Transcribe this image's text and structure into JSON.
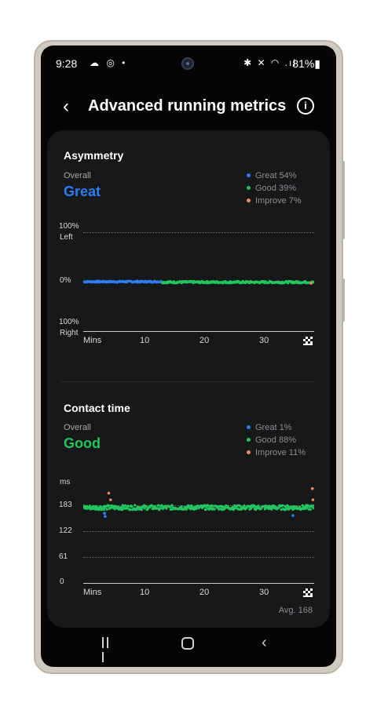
{
  "status_bar": {
    "time": "9:28",
    "left_icons": "☁ ◎ •",
    "right_icons": "✱ ✕ ◠ .ıl",
    "battery": "81%▮"
  },
  "header": {
    "back_glyph": "‹",
    "title": "Advanced running metrics",
    "info_glyph": "i"
  },
  "asymmetry": {
    "title": "Asymmetry",
    "overall_label": "Overall",
    "rating": "Great",
    "rating_color": "#2f7cf6",
    "legend": [
      {
        "label": "Great 54%",
        "color": "#2f7cf6"
      },
      {
        "label": "Good 39%",
        "color": "#22c55e"
      },
      {
        "label": "Improve 7%",
        "color": "#f08a5d"
      }
    ],
    "y_labels": {
      "top": "100%",
      "top_sub": "Left",
      "mid": "0%",
      "bottom": "100%",
      "bottom_sub": "Right"
    },
    "x_labels": [
      "Mins",
      "10",
      "20",
      "30"
    ]
  },
  "contact_time": {
    "title": "Contact time",
    "overall_label": "Overall",
    "rating": "Good",
    "rating_color": "#22c55e",
    "legend": [
      {
        "label": "Great 1%",
        "color": "#2f7cf6"
      },
      {
        "label": "Good 88%",
        "color": "#22c55e"
      },
      {
        "label": "Improve 11%",
        "color": "#f08a5d"
      }
    ],
    "unit": "ms",
    "y_labels": [
      "183",
      "122",
      "61",
      "0"
    ],
    "x_labels": [
      "Mins",
      "10",
      "20",
      "30"
    ],
    "average": "Avg. 168"
  },
  "chart_data": [
    {
      "type": "scatter",
      "title": "Asymmetry",
      "xlabel": "Mins",
      "ylabel": "",
      "xlim": [
        0,
        38
      ],
      "ylim": [
        -100,
        100
      ],
      "grid": true,
      "series": [
        {
          "name": "Great",
          "color": "#2f7cf6",
          "x_range": [
            0,
            13
          ],
          "y_center": 0,
          "spread": 1.5
        },
        {
          "name": "Good",
          "color": "#22c55e",
          "x_range": [
            13,
            38
          ],
          "y_center": -1,
          "spread": 2
        },
        {
          "name": "Improve",
          "color": "#f08a5d",
          "points": [
            [
              37.5,
              -3
            ]
          ]
        }
      ]
    },
    {
      "type": "scatter",
      "title": "Contact time",
      "xlabel": "Mins",
      "ylabel": "ms",
      "xlim": [
        0,
        38
      ],
      "ylim": [
        0,
        220
      ],
      "yticks": [
        0,
        61,
        122,
        183
      ],
      "grid": true,
      "series": [
        {
          "name": "Good",
          "color": "#22c55e",
          "x_range": [
            0,
            38
          ],
          "y_center": 168,
          "spread": 5
        },
        {
          "name": "Improve",
          "color": "#f08a5d",
          "points": [
            [
              4.2,
              200
            ],
            [
              4.5,
              185
            ],
            [
              37.7,
              210
            ],
            [
              37.8,
              185
            ]
          ]
        },
        {
          "name": "Great",
          "color": "#2f7cf6",
          "points": [
            [
              3.5,
              155
            ],
            [
              3.6,
              148
            ],
            [
              34.5,
              150
            ]
          ]
        }
      ]
    }
  ]
}
